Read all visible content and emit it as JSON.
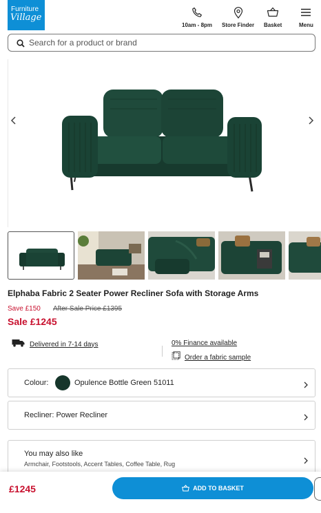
{
  "brand": {
    "logo_line1": "Furniture",
    "logo_line2": "Village",
    "color": "#0e8fd6"
  },
  "header": {
    "hours_label": "10am - 8pm",
    "store_finder_label": "Store Finder",
    "basket_label": "Basket",
    "menu_label": "Menu"
  },
  "search": {
    "placeholder": "Search for a product or brand"
  },
  "product": {
    "title": "Elphaba Fabric 2 Seater Power Recliner Sofa with Storage Arms",
    "save_text": "Save £150",
    "after_sale_text": "After Sale Price £1395",
    "sale_text": "Sale £1245",
    "sale_color": "#c8102e"
  },
  "delivery": {
    "text": "Delivered in 7-14 days"
  },
  "finance": {
    "text": "0% Finance available"
  },
  "fabric_sample": {
    "text": "Order a fabric sample"
  },
  "options": {
    "colour_label": "Colour:",
    "colour_value": "Opulence Bottle Green 51011",
    "colour_swatch": "#16362b",
    "recliner_label": "Recliner: Power Recliner"
  },
  "also_like": {
    "title": "You may also like",
    "subtitle": "Armchair, Footstools, Accent Tables, Coffee Table, Rug"
  },
  "sticky_bar": {
    "price": "£1245",
    "button_label": "ADD TO BASKET"
  }
}
